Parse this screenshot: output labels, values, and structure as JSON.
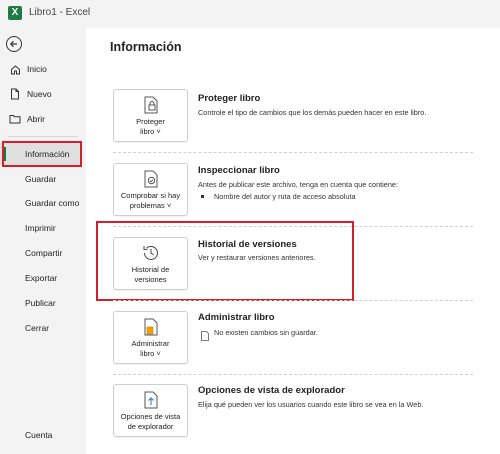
{
  "window": {
    "title": "Libro1  -  Excel"
  },
  "sidebar": {
    "items": [
      {
        "label": "Inicio",
        "icon": "home-icon"
      },
      {
        "label": "Nuevo",
        "icon": "new-document-icon"
      },
      {
        "label": "Abrir",
        "icon": "open-folder-icon"
      },
      {
        "label": "Información",
        "active": true
      },
      {
        "label": "Guardar"
      },
      {
        "label": "Guardar como"
      },
      {
        "label": "Imprimir"
      },
      {
        "label": "Compartir"
      },
      {
        "label": "Exportar"
      },
      {
        "label": "Publicar"
      },
      {
        "label": "Cerrar"
      }
    ],
    "account_label": "Cuenta"
  },
  "main": {
    "title": "Información",
    "sections": [
      {
        "button_line1": "Proteger",
        "button_line2": "libro ˅",
        "icon": "protect-lock-icon",
        "title": "Proteger libro",
        "description": "Controle el tipo de cambios que los demás pueden hacer en este libro."
      },
      {
        "button_line1": "Comprobar si hay",
        "button_line2": "problemas ˅",
        "icon": "inspect-document-icon",
        "title": "Inspeccionar libro",
        "description": "Antes de publicar este archivo, tenga en cuenta que contiene:",
        "bullet": "Nombre del autor y ruta de acceso absoluta"
      },
      {
        "button_line1": "Historial de",
        "button_line2": "versiones",
        "icon": "version-history-icon",
        "title": "Historial de versiones",
        "description": "Ver y restaurar versiones anteriores."
      },
      {
        "button_line1": "Administrar",
        "button_line2": "libro ˅",
        "icon": "manage-workbook-icon",
        "title": "Administrar libro",
        "description": "No existen cambios sin guardar."
      },
      {
        "button_line1": "Opciones de vista",
        "button_line2": "de explorador",
        "icon": "browser-view-icon",
        "title": "Opciones de vista de explorador",
        "description": "Elija qué pueden ver los usuarios cuando este libro se vea en la Web."
      }
    ]
  },
  "colors": {
    "highlight_red": "#d0212b",
    "excel_green": "#107c41",
    "active_bg": "#e0e0e0"
  }
}
